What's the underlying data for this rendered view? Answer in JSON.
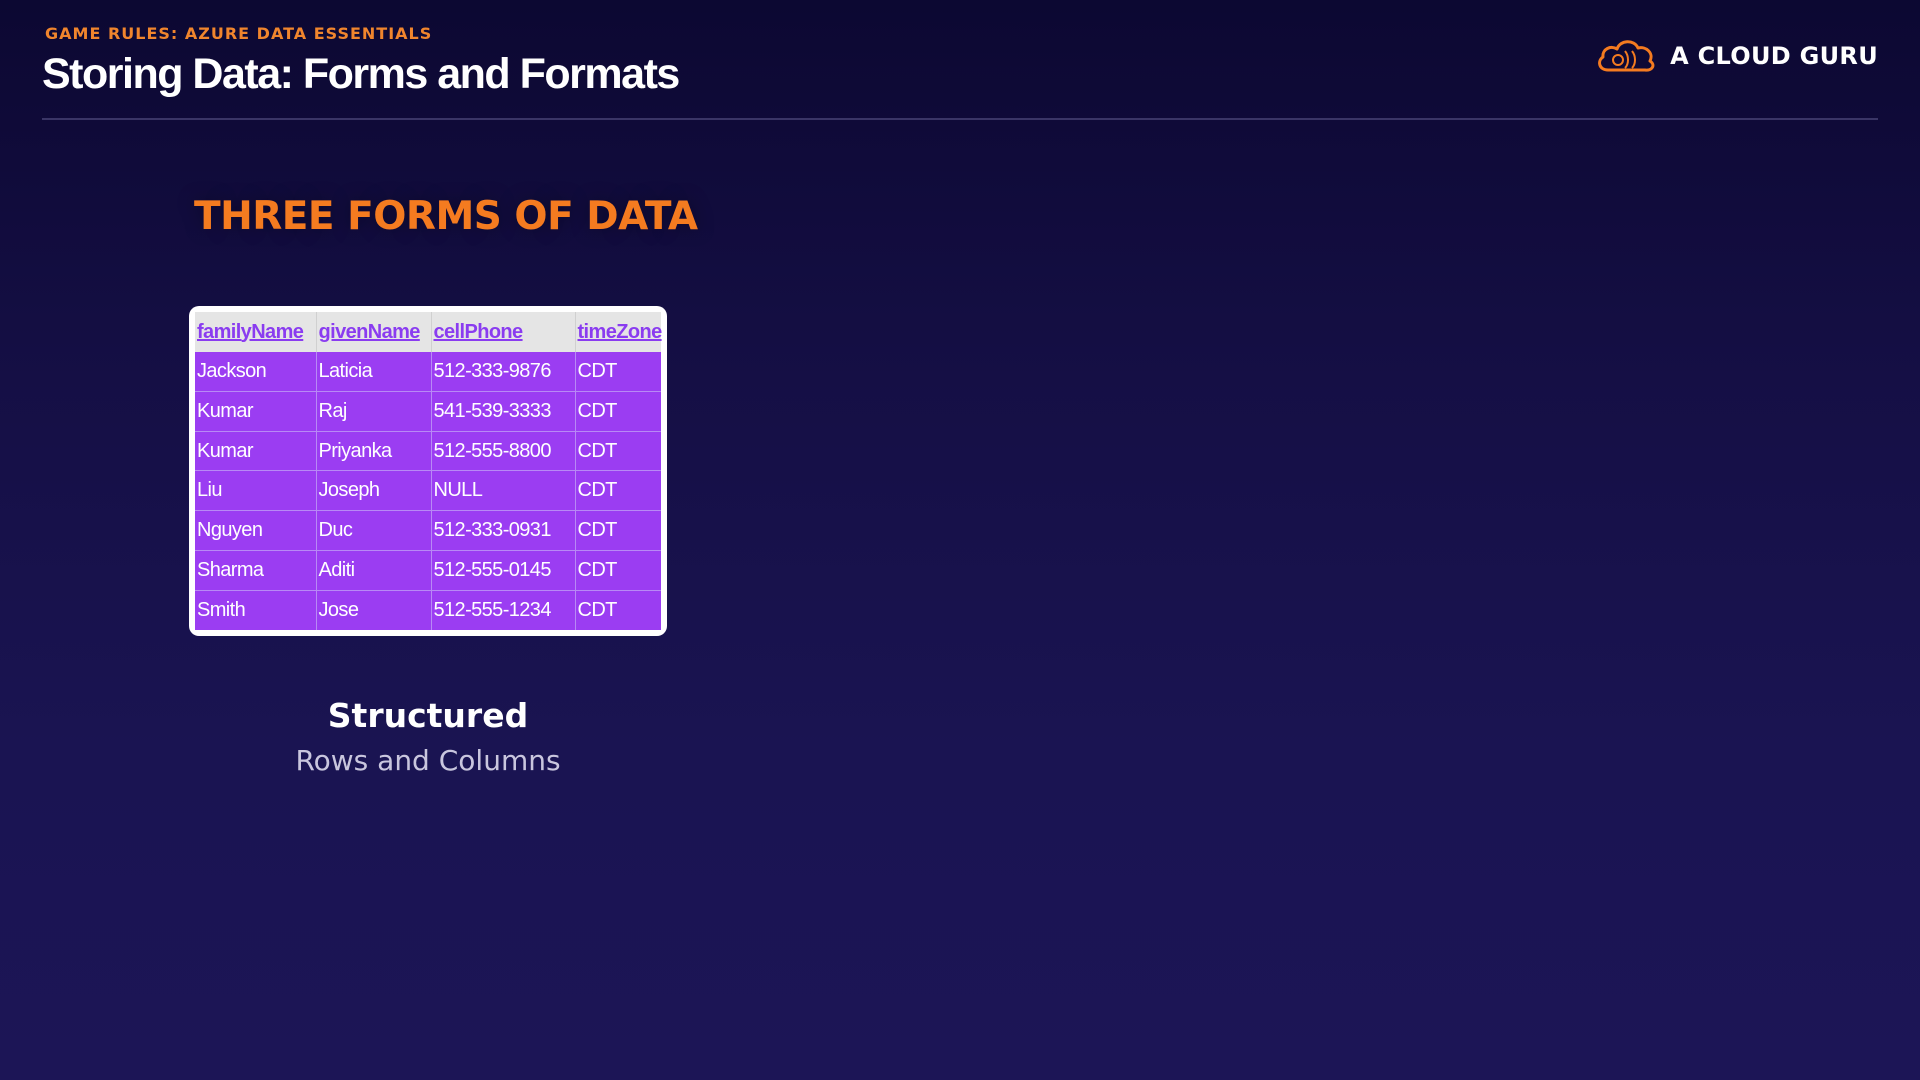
{
  "header": {
    "eyebrow": "GAME RULES: AZURE DATA ESSENTIALS",
    "title": "Storing Data: Forms and Formats",
    "brand_name": "A CLOUD GURU",
    "brand_icon": "cloud-logo-icon"
  },
  "section": {
    "heading": "THREE FORMS OF DATA"
  },
  "table": {
    "columns": [
      "familyName",
      "givenName",
      "cellPhone",
      "timeZone"
    ],
    "rows": [
      [
        "Jackson",
        "Laticia",
        "512-333-9876",
        "CDT"
      ],
      [
        "Kumar",
        "Raj",
        "541-539-3333",
        "CDT"
      ],
      [
        "Kumar",
        "Priyanka",
        "512-555-8800",
        "CDT"
      ],
      [
        "Liu",
        "Joseph",
        "NULL",
        "CDT"
      ],
      [
        "Nguyen",
        "Duc",
        "512-333-0931",
        "CDT"
      ],
      [
        "Sharma",
        "Aditi",
        "512-555-0145",
        "CDT"
      ],
      [
        "Smith",
        "Jose",
        "512-555-1234",
        "CDT"
      ]
    ]
  },
  "caption": {
    "title": "Structured",
    "subtitle": "Rows and Columns"
  },
  "colors": {
    "accent_orange": "#f47b20",
    "table_purple": "#9b3df2",
    "header_link_purple": "#8a3cf0",
    "background_navy": "#150f45"
  }
}
